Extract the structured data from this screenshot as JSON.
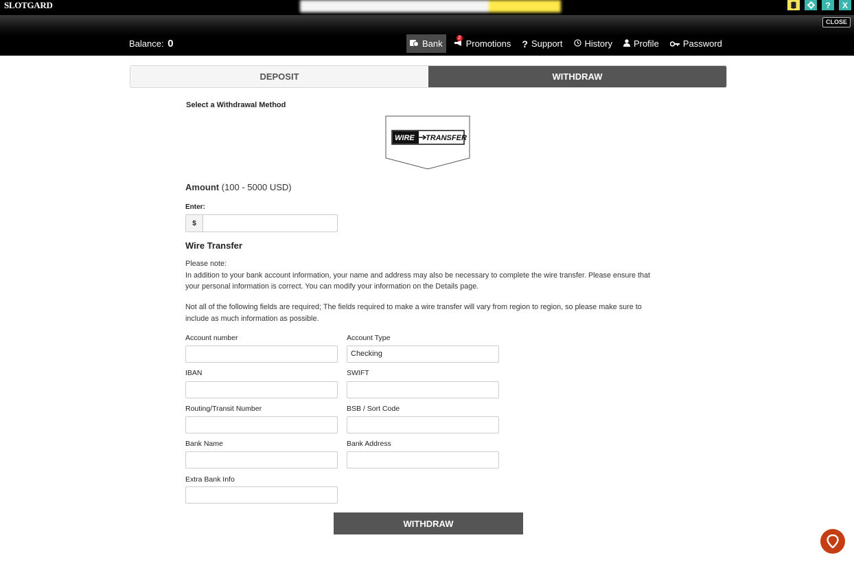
{
  "topbar": {
    "logo": "SLOTGARD",
    "icons": [
      "coin-icon",
      "gear-icon",
      "help-icon",
      "close-icon"
    ]
  },
  "header": {
    "close_label": "CLOSE",
    "balance_label": "Balance:",
    "balance_value": "0",
    "nav": [
      {
        "label": "Bank",
        "icon": "bank-icon",
        "active": true
      },
      {
        "label": "Promotions",
        "icon": "megaphone-icon",
        "badge": "2"
      },
      {
        "label": "Support",
        "icon": "question-icon"
      },
      {
        "label": "History",
        "icon": "history-icon"
      },
      {
        "label": "Profile",
        "icon": "user-icon"
      },
      {
        "label": "Password",
        "icon": "key-icon"
      }
    ]
  },
  "tabs": {
    "deposit": "DEPOSIT",
    "withdraw": "WITHDRAW"
  },
  "withdrawal": {
    "select_label": "Select a Withdrawal Method",
    "method_logo_left": "WIRE",
    "method_logo_right": "TRANSFER",
    "amount_label": "Amount",
    "amount_range": "(100 - 5000 USD)",
    "enter_label": "Enter:",
    "currency_symbol": "$",
    "amount_value": ""
  },
  "wire": {
    "title": "Wire Transfer",
    "note_heading": "Please note:",
    "note_body": "In addition to your bank account information, your name and address may also be necessary to complete the wire transfer. Please ensure that your personal information is correct. You can modify your information on the Details page.",
    "note2": "Not all of the following fields are required; The fields required to make a wire transfer will vary from region to region, so please make sure to include as much information as possible."
  },
  "fields": {
    "account_number": {
      "label": "Account number",
      "value": ""
    },
    "account_type": {
      "label": "Account Type",
      "value": "Checking"
    },
    "iban": {
      "label": "IBAN",
      "value": ""
    },
    "swift": {
      "label": "SWIFT",
      "value": ""
    },
    "routing": {
      "label": "Routing/Transit Number",
      "value": ""
    },
    "bsb": {
      "label": "BSB / Sort Code",
      "value": ""
    },
    "bank_name": {
      "label": "Bank Name",
      "value": ""
    },
    "bank_address": {
      "label": "Bank Address",
      "value": ""
    },
    "extra_info": {
      "label": "Extra Bank Info",
      "value": ""
    }
  },
  "submit_label": "WITHDRAW",
  "colors": {
    "header_bg": "#000000",
    "tab_active": "#555555",
    "accent_teal": "#39b5ac",
    "coin_yellow": "#f1e45a",
    "chat_orange": "#c43d13",
    "badge_red": "#e21f26"
  }
}
